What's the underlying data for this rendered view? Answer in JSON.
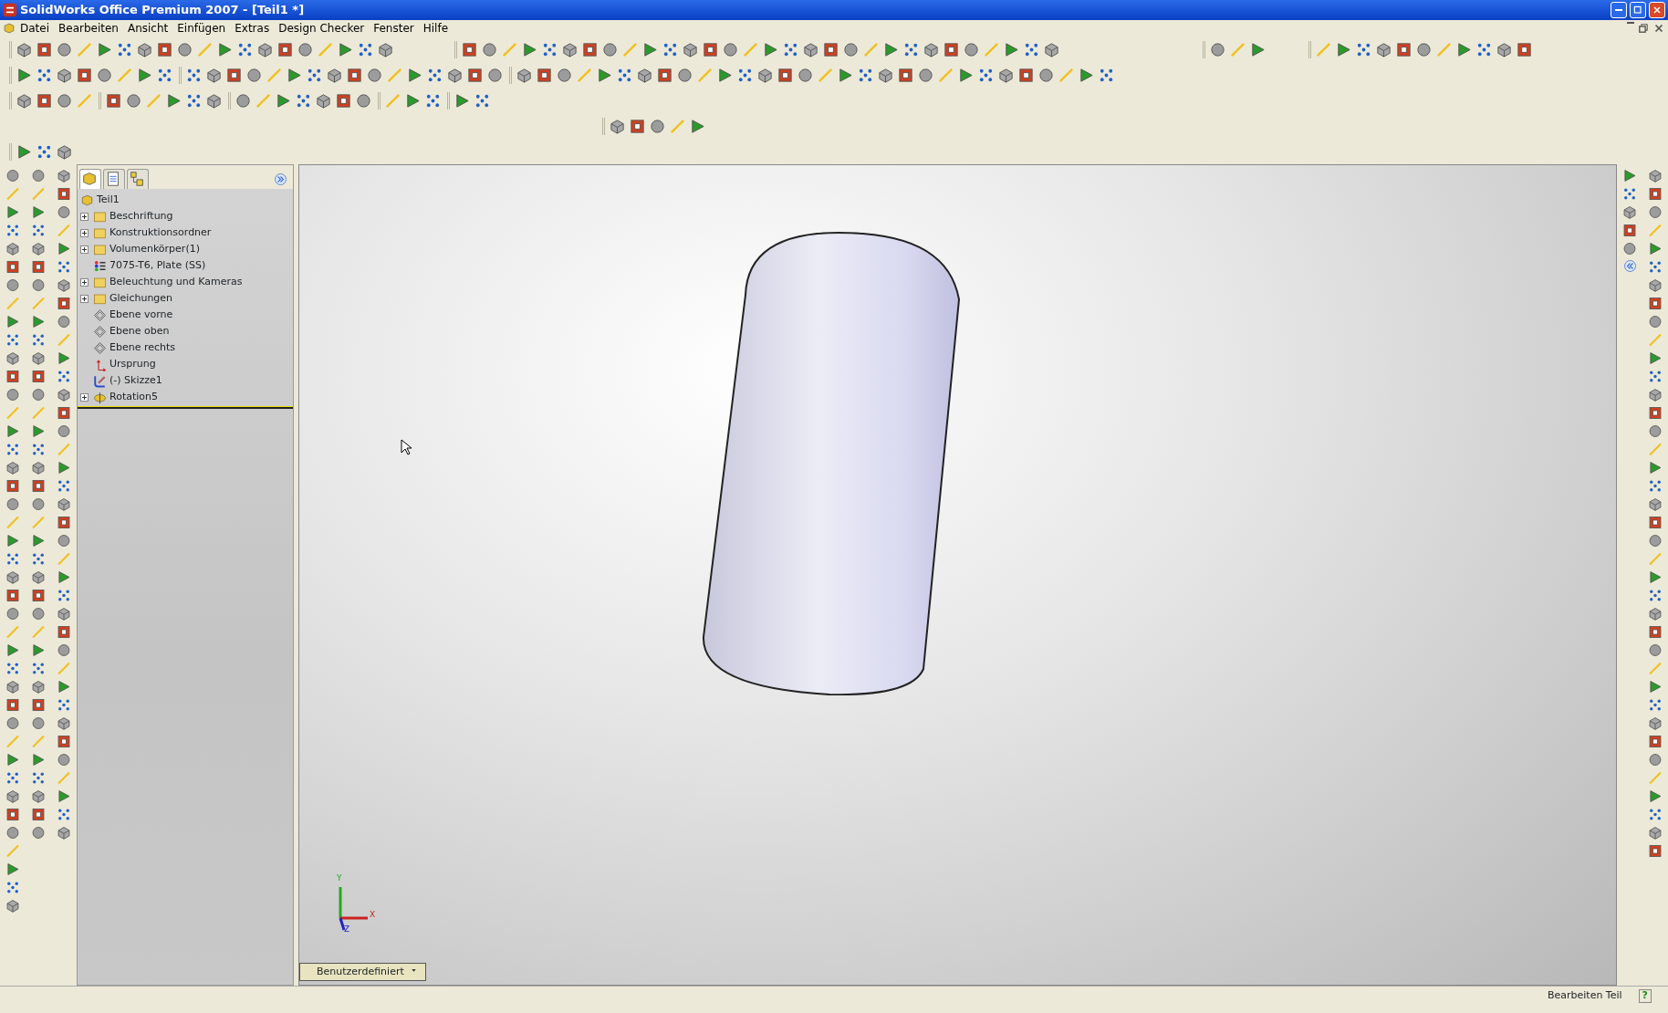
{
  "window": {
    "title": "SolidWorks Office Premium 2007 - [Teil1 *]"
  },
  "menu": [
    "Datei",
    "Bearbeiten",
    "Ansicht",
    "Einfügen",
    "Extras",
    "Design Checker",
    "Fenster",
    "Hilfe"
  ],
  "feature_tree": {
    "tabs": [
      {
        "selected": true
      },
      {
        "selected": false
      },
      {
        "selected": false
      }
    ],
    "items": [
      {
        "label": "Teil1",
        "kind": "part",
        "collapsed": false
      },
      {
        "label": "Beschriftung",
        "kind": "folder",
        "collapsed": true
      },
      {
        "label": "Konstruktionsordner",
        "kind": "folder",
        "collapsed": true
      },
      {
        "label": "Volumenkörper(1)",
        "kind": "folder",
        "collapsed": true
      },
      {
        "label": "7075-T6, Plate (SS)",
        "kind": "material",
        "collapsed": false
      },
      {
        "label": "Beleuchtung und Kameras",
        "kind": "folder",
        "collapsed": true
      },
      {
        "label": "Gleichungen",
        "kind": "folder",
        "collapsed": true
      },
      {
        "label": "Ebene vorne",
        "kind": "plane",
        "collapsed": false
      },
      {
        "label": "Ebene oben",
        "kind": "plane",
        "collapsed": false
      },
      {
        "label": "Ebene rechts",
        "kind": "plane",
        "collapsed": false
      },
      {
        "label": "Ursprung",
        "kind": "origin",
        "collapsed": false
      },
      {
        "label": "(-) Skizze1",
        "kind": "sketch",
        "collapsed": false
      },
      {
        "label": "Rotation5",
        "kind": "feature",
        "collapsed": true
      }
    ]
  },
  "viewport": {
    "triad": {
      "y_label": "Y",
      "x_label": "X",
      "z_label": "Z"
    },
    "view_orientation": "Benutzerdefiniert"
  },
  "status_bar": {
    "text": "Bearbeiten Teil",
    "help": "?"
  }
}
